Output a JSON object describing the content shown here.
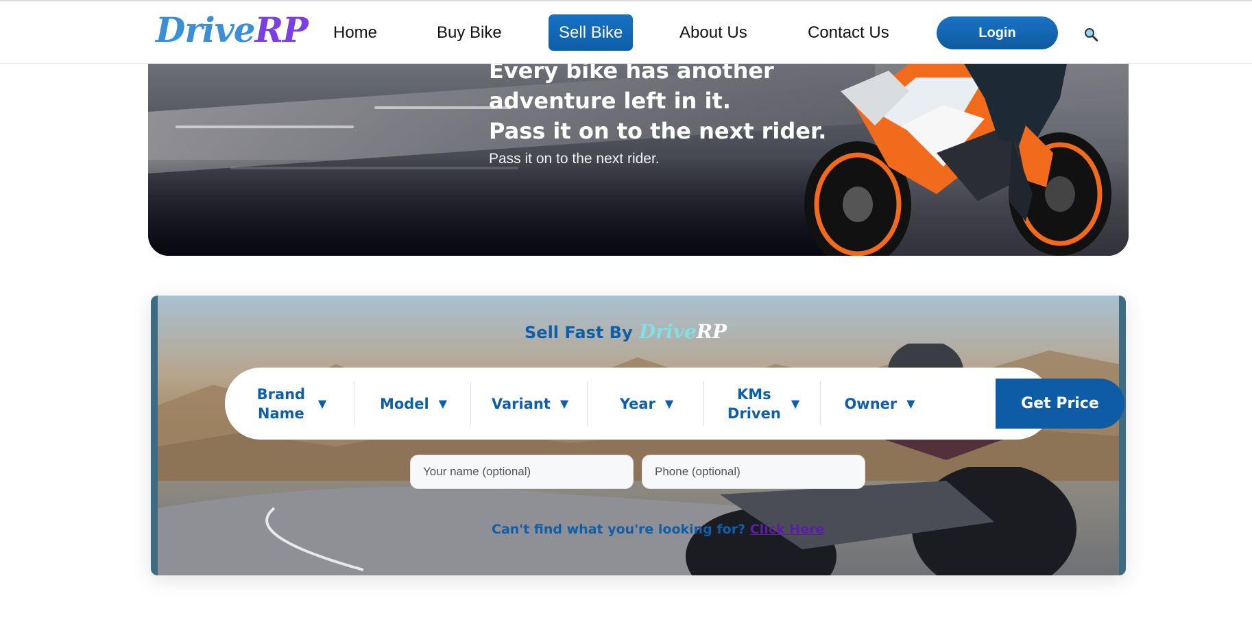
{
  "brand": {
    "part1": "Drive",
    "part2": "RP",
    "color1": "#3a8fd6",
    "color2": "#7b3fe4"
  },
  "nav": {
    "items": [
      {
        "label": "Home",
        "active": false
      },
      {
        "label": "Buy Bike",
        "active": false
      },
      {
        "label": "Sell Bike",
        "active": true
      },
      {
        "label": "About Us",
        "active": false
      },
      {
        "label": "Contact Us",
        "active": false
      }
    ],
    "login_label": "Login",
    "search_icon": "magnifier-icon"
  },
  "hero": {
    "title_line1": "Every bike has another",
    "title_line2": "adventure left in it.",
    "title_line3": "Pass it on to the next rider.",
    "subtitle": "Pass it on to the next rider."
  },
  "sell": {
    "title": "Sell Fast By",
    "logo_part1": "Drive",
    "logo_part2": "RP",
    "filters": [
      {
        "label": "Brand Name",
        "icon": "caret-down-icon"
      },
      {
        "label": "Model",
        "icon": "caret-down-icon"
      },
      {
        "label": "Variant",
        "icon": "caret-down-icon"
      },
      {
        "label": "Year",
        "icon": "caret-down-icon"
      },
      {
        "label": "KMs Driven",
        "icon": "caret-down-icon"
      },
      {
        "label": "Owner",
        "icon": "caret-down-icon"
      }
    ],
    "arrow": "▼",
    "get_price_label": "Get Price",
    "name_placeholder": "Your name (optional)",
    "phone_placeholder": "Phone (optional)",
    "help_text": "Can't find what you're looking for?",
    "help_link": "Click Here",
    "accent": "#0f5ea8"
  }
}
